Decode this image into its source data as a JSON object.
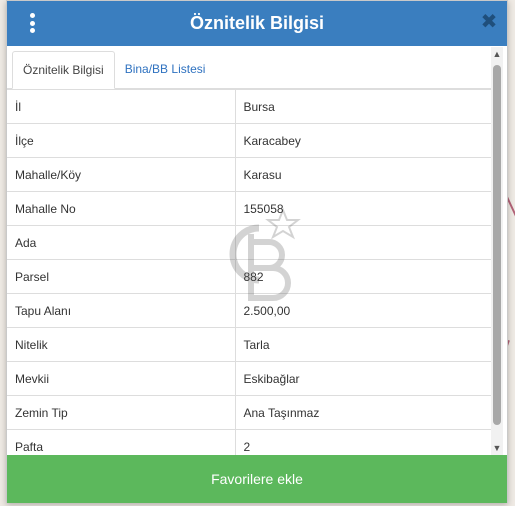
{
  "dialog": {
    "title": "Öznitelik Bilgisi",
    "close_label": "✖"
  },
  "tabs": [
    {
      "label": "Öznitelik Bilgisi",
      "active": true
    },
    {
      "label": "Bina/BB Listesi",
      "active": false
    }
  ],
  "attributes": [
    {
      "key": "İl",
      "value": "Bursa"
    },
    {
      "key": "İlçe",
      "value": "Karacabey"
    },
    {
      "key": "Mahalle/Köy",
      "value": "Karasu"
    },
    {
      "key": "Mahalle No",
      "value": "155058"
    },
    {
      "key": "Ada",
      "value": ""
    },
    {
      "key": "Parsel",
      "value": "882"
    },
    {
      "key": "Tapu Alanı",
      "value": "2.500,00"
    },
    {
      "key": "Nitelik",
      "value": "Tarla"
    },
    {
      "key": "Mevkii",
      "value": "Eskibağlar"
    },
    {
      "key": "Zemin Tip",
      "value": "Ana Taşınmaz"
    },
    {
      "key": "Pafta",
      "value": "2"
    }
  ],
  "footer": {
    "button_label": "Favorilere ekle"
  },
  "icons": {
    "menu": "vertical-dots-icon",
    "close": "close-icon",
    "watermark": "cb-logo-watermark"
  },
  "colors": {
    "header": "#3a7ebf",
    "tab_link": "#2f72c0",
    "footer_button": "#5cb85c"
  }
}
